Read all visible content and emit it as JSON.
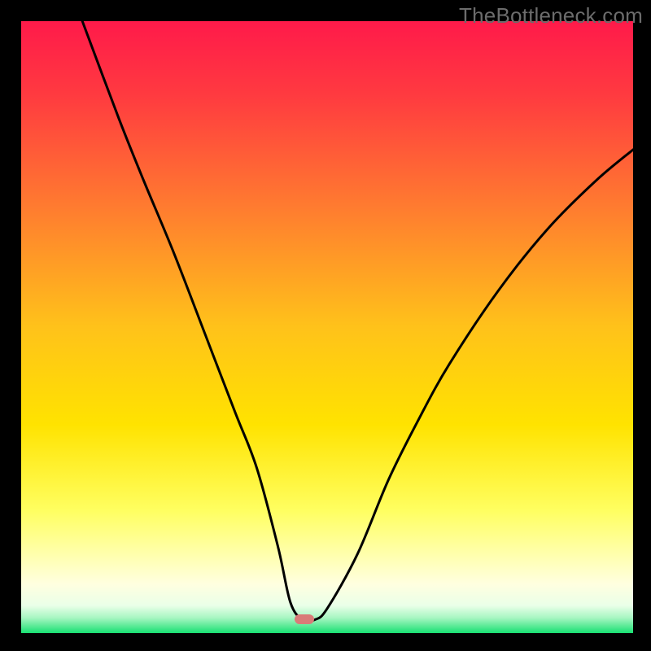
{
  "watermark": "TheBottleneck.com",
  "gradient": {
    "top": "#ff1a4a",
    "upper_mid": "#ff8a2a",
    "mid": "#ffd400",
    "lower_mid": "#ffff66",
    "pale": "#ffffe0",
    "green": "#18e072"
  },
  "marker": {
    "x_pct": 46.3,
    "y_pct": 97.8,
    "color": "#d97b78"
  },
  "chart_data": {
    "type": "line",
    "title": "",
    "xlabel": "",
    "ylabel": "",
    "xlim": [
      0,
      100
    ],
    "ylim": [
      0,
      100
    ],
    "series": [
      {
        "name": "bottleneck-curve",
        "x": [
          10,
          16,
          20,
          25,
          30,
          35,
          38.5,
          42,
          44,
          46,
          48,
          50,
          55,
          60,
          65,
          70,
          78,
          86,
          94,
          100
        ],
        "y": [
          100,
          84,
          74,
          62,
          49,
          36,
          27,
          14,
          5,
          2.2,
          2.2,
          4,
          13,
          25,
          35,
          44,
          56,
          66,
          74,
          79
        ]
      }
    ],
    "marker": {
      "x": 46.3,
      "y": 2.2
    },
    "background_gradient_vertical_stops": [
      {
        "pct": 0,
        "color": "#ff1a4a"
      },
      {
        "pct": 12,
        "color": "#ff3a40"
      },
      {
        "pct": 30,
        "color": "#ff7a30"
      },
      {
        "pct": 50,
        "color": "#ffc21a"
      },
      {
        "pct": 66,
        "color": "#ffe300"
      },
      {
        "pct": 80,
        "color": "#ffff61"
      },
      {
        "pct": 92,
        "color": "#ffffe0"
      },
      {
        "pct": 97,
        "color": "#c4ffd4"
      },
      {
        "pct": 100,
        "color": "#18e072"
      }
    ]
  }
}
